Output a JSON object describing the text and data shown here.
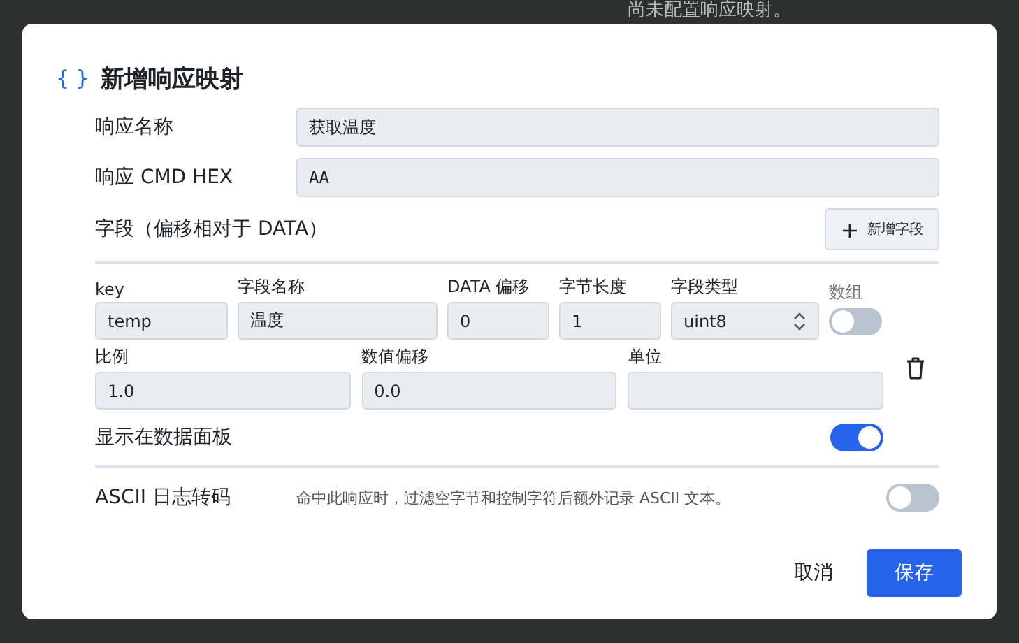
{
  "background": {
    "text": "尚未配置响应映射。"
  },
  "dialog": {
    "icon": "{ }",
    "title": "新增响应映射",
    "fields": [
      {
        "label": "响应名称",
        "value": "获取温度"
      },
      {
        "label": "响应 CMD HEX",
        "value": "AA"
      }
    ],
    "fields_section": {
      "label": "字段（偏移相对于 DATA）",
      "add_button": {
        "icon": "+",
        "label": "新增字段"
      }
    },
    "field_item": {
      "row_1": [
        {
          "kind": "text",
          "label": "key",
          "value": "temp"
        },
        {
          "kind": "text",
          "label": "字段名称",
          "value": "温度"
        },
        {
          "kind": "text",
          "label": "DATA 偏移",
          "value": "0"
        },
        {
          "kind": "text",
          "label": "字节长度",
          "value": "1"
        },
        {
          "kind": "select",
          "label": "字段类型",
          "value": "uint8"
        },
        {
          "kind": "toggle",
          "label": "数组",
          "on": false
        }
      ],
      "row_2": [
        {
          "kind": "text",
          "label": "比例",
          "value": "1.0"
        },
        {
          "kind": "text",
          "label": "数值偏移",
          "value": "0.0"
        },
        {
          "kind": "text",
          "label": "单位"
        }
      ],
      "show_on_panel": {
        "label": "显示在数据面板",
        "on": true
      }
    },
    "ascii": {
      "label": "ASCII 日志转码",
      "description": "命中此响应时，过滤空字节和控制字符后额外记录 ASCII 文本。",
      "on": false
    },
    "buttons": [
      {
        "kind": "text",
        "label": "取消"
      },
      {
        "kind": "primary",
        "label": "保存"
      }
    ]
  }
}
